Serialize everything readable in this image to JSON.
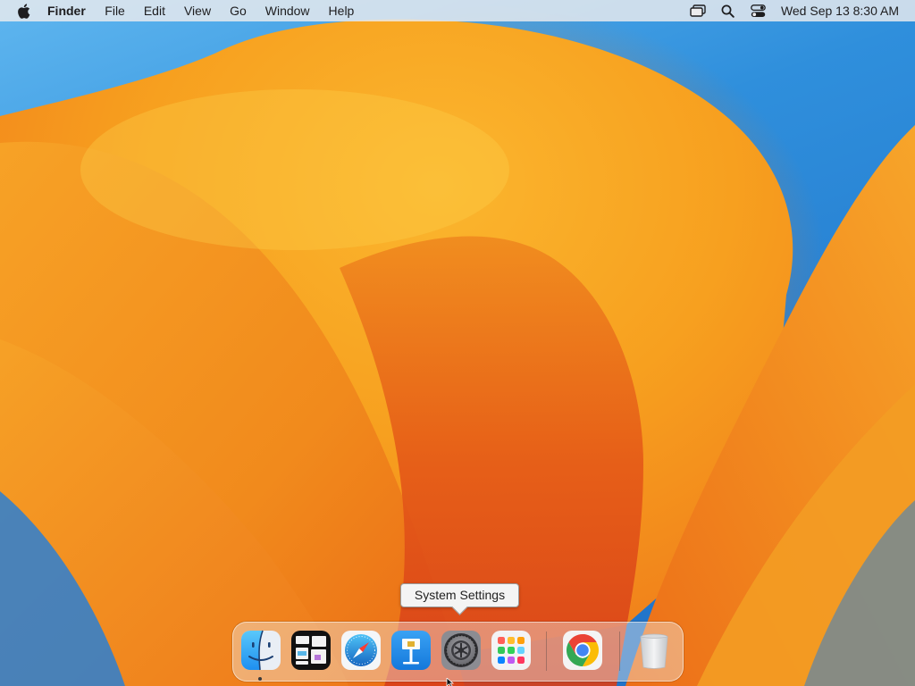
{
  "menubar": {
    "apple_icon": "apple-logo-icon",
    "app_name": "Finder",
    "menus": [
      "File",
      "Edit",
      "View",
      "Go",
      "Window",
      "Help"
    ],
    "status_icons": [
      "screen-mirroring-icon",
      "spotlight-search-icon",
      "control-center-icon"
    ],
    "clock": "Wed Sep 13  8:30 AM"
  },
  "tooltip": {
    "text": "System Settings"
  },
  "dock": {
    "apps": [
      {
        "name": "Finder",
        "icon": "finder-icon",
        "running": true
      },
      {
        "name": "Mission Control",
        "icon": "mission-control-icon",
        "running": false
      },
      {
        "name": "Safari",
        "icon": "safari-icon",
        "running": false
      },
      {
        "name": "Keynote",
        "icon": "keynote-icon",
        "running": false
      },
      {
        "name": "System Settings",
        "icon": "system-settings-icon",
        "running": false
      },
      {
        "name": "Launchpad",
        "icon": "launchpad-icon",
        "running": false
      },
      {
        "name": "Google Chrome",
        "icon": "chrome-icon",
        "running": false
      },
      {
        "name": "Trash",
        "icon": "trash-icon",
        "running": false
      }
    ]
  },
  "colors": {
    "wallpaper_orange": "#f28a1e",
    "wallpaper_blue": "#2f8fdc",
    "menubar_bg": "#ececee",
    "finder_blue": "#1e8ff0"
  }
}
